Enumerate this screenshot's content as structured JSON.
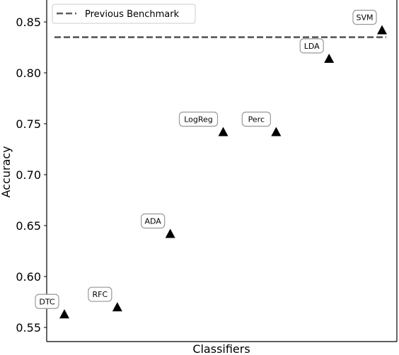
{
  "chart_data": {
    "type": "scatter",
    "title": "",
    "xlabel": "Classifiers",
    "ylabel": "Accuracy",
    "ylim": [
      0.532,
      0.874
    ],
    "yticks": [
      0.55,
      0.6,
      0.65,
      0.7,
      0.75,
      0.8,
      0.85
    ],
    "ytick_labels": [
      "0.55",
      "0.60",
      "0.65",
      "0.70",
      "0.75",
      "0.80",
      "0.85"
    ],
    "grid": false,
    "marker": "triangle",
    "marker_color": "#000000",
    "categories": [
      "DTC",
      "RFC",
      "ADA",
      "LogReg",
      "Perc",
      "LDA",
      "SVM"
    ],
    "values": [
      0.563,
      0.57,
      0.642,
      0.742,
      0.742,
      0.814,
      0.842
    ],
    "reference_line": {
      "name": "Previous Benchmark",
      "value": 0.835,
      "style": "dashed",
      "color": "#5f5f5f"
    },
    "legend": {
      "entries": [
        "Previous Benchmark"
      ],
      "placement": "top-left"
    }
  }
}
